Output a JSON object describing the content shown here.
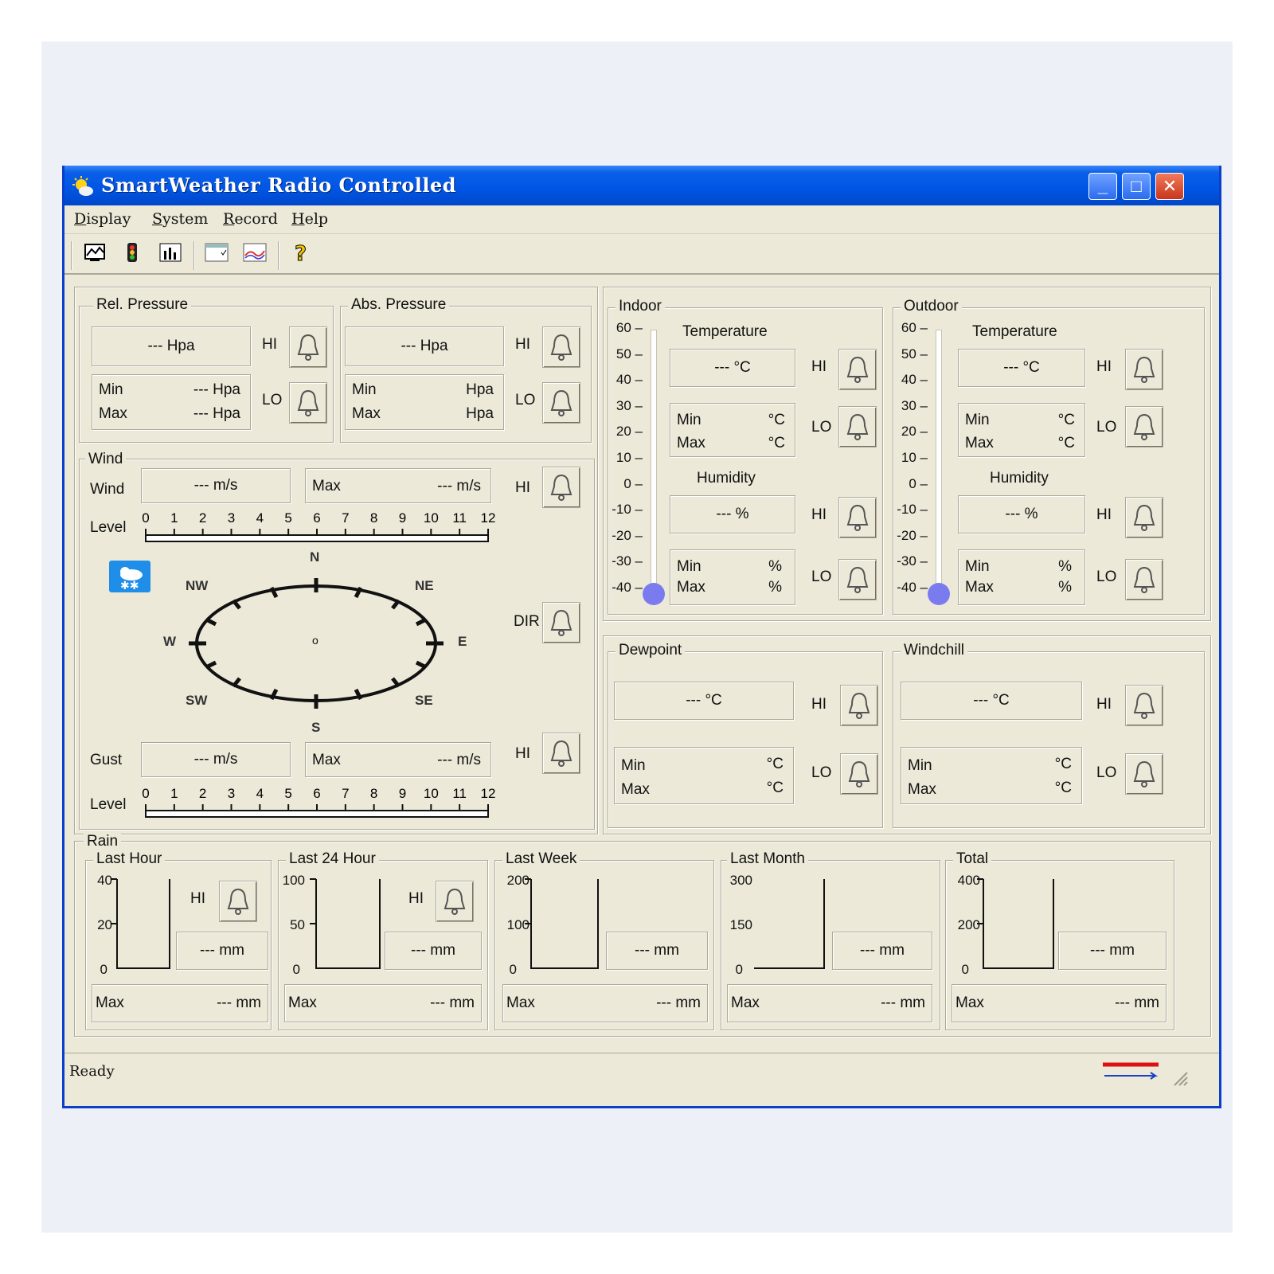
{
  "window": {
    "title": "SmartWeather Radio Controlled"
  },
  "titlebar_buttons": {
    "minimize": "_",
    "maximize": "□",
    "close": "✕"
  },
  "menu": [
    "Display",
    "System",
    "Record",
    "Help"
  ],
  "toolbar": {
    "icons": [
      "display-icon",
      "traffic-light-icon",
      "bar-chart-icon",
      "calendar-icon",
      "line-graph-icon",
      "help-icon"
    ]
  },
  "pressure": {
    "rel": {
      "label": "Rel. Pressure",
      "value": "--- Hpa",
      "min_label": "Min",
      "min_value": "--- Hpa",
      "max_label": "Max",
      "max_value": "--- Hpa",
      "hi": "HI",
      "lo": "LO"
    },
    "abs": {
      "label": "Abs. Pressure",
      "value": "--- Hpa",
      "min_label": "Min",
      "min_value": "Hpa",
      "max_label": "Max",
      "max_value": "Hpa",
      "hi": "HI",
      "lo": "LO"
    }
  },
  "wind": {
    "label": "Wind",
    "wind_label": "Wind",
    "wind_value": "--- m/s",
    "wind_max_label": "Max",
    "wind_max_value": "--- m/s",
    "hi": "HI",
    "level_label": "Level",
    "level_scale": [
      "0",
      "1",
      "2",
      "3",
      "4",
      "5",
      "6",
      "7",
      "8",
      "9",
      "10",
      "11",
      "12"
    ],
    "compass": {
      "n": "N",
      "ne": "NE",
      "e": "E",
      "se": "SE",
      "s": "S",
      "sw": "SW",
      "w": "W",
      "nw": "NW",
      "center": "o"
    },
    "dir_label": "DIR",
    "gust_label": "Gust",
    "gust_value": "--- m/s",
    "gust_max_label": "Max",
    "gust_max_value": "--- m/s",
    "gust_hi": "HI",
    "gust_level_label": "Level"
  },
  "indoor": {
    "label": "Indoor",
    "scale": [
      "60",
      "50",
      "40",
      "30",
      "20",
      "10",
      "0",
      "-10",
      "-20",
      "-30",
      "-40"
    ],
    "temp_label": "Temperature",
    "temp_value": "--- °C",
    "temp_min_label": "Min",
    "temp_min_unit": "°C",
    "temp_max_label": "Max",
    "temp_max_unit": "°C",
    "hum_label": "Humidity",
    "hum_value": "--- %",
    "hum_min_label": "Min",
    "hum_min_unit": "%",
    "hum_max_label": "Max",
    "hum_max_unit": "%",
    "hi": "HI",
    "lo": "LO"
  },
  "outdoor": {
    "label": "Outdoor",
    "scale": [
      "60",
      "50",
      "40",
      "30",
      "20",
      "10",
      "0",
      "-10",
      "-20",
      "-30",
      "-40"
    ],
    "temp_label": "Temperature",
    "temp_value": "--- °C",
    "temp_min_label": "Min",
    "temp_min_unit": "°C",
    "temp_max_label": "Max",
    "temp_max_unit": "°C",
    "hum_label": "Humidity",
    "hum_value": "--- %",
    "hum_min_label": "Min",
    "hum_min_unit": "%",
    "hum_max_label": "Max",
    "hum_max_unit": "%",
    "hi": "HI",
    "lo": "LO"
  },
  "dewpoint": {
    "label": "Dewpoint",
    "value": "--- °C",
    "min_label": "Min",
    "min_unit": "°C",
    "max_label": "Max",
    "max_unit": "°C",
    "hi": "HI",
    "lo": "LO"
  },
  "windchill": {
    "label": "Windchill",
    "value": "--- °C",
    "min_label": "Min",
    "min_unit": "°C",
    "max_label": "Max",
    "max_unit": "°C",
    "hi": "HI",
    "lo": "LO"
  },
  "rain": {
    "label": "Rain",
    "panels": [
      {
        "title": "Last Hour",
        "axis": [
          "40",
          "20",
          "0"
        ],
        "hi": "HI",
        "value": "--- mm",
        "max_label": "Max",
        "max_value": "--- mm"
      },
      {
        "title": "Last 24 Hour",
        "axis": [
          "100",
          "50",
          "0"
        ],
        "hi": "HI",
        "value": "--- mm",
        "max_label": "Max",
        "max_value": "--- mm"
      },
      {
        "title": "Last Week",
        "axis": [
          "200",
          "100",
          "0"
        ],
        "value": "--- mm",
        "max_label": "Max",
        "max_value": "--- mm"
      },
      {
        "title": "Last Month",
        "axis": [
          "300",
          "150",
          "0"
        ],
        "value": "--- mm",
        "max_label": "Max",
        "max_value": "--- mm"
      },
      {
        "title": "Total",
        "axis": [
          "400",
          "200",
          "0"
        ],
        "value": "--- mm",
        "max_label": "Max",
        "max_value": "--- mm"
      }
    ]
  },
  "status": {
    "text": "Ready"
  },
  "colors": {
    "titlebar": "#0055e5",
    "face": "#ece9d8",
    "thermo_bulb": "#7b7bf0",
    "weather_icon": "#1e8ee8"
  }
}
